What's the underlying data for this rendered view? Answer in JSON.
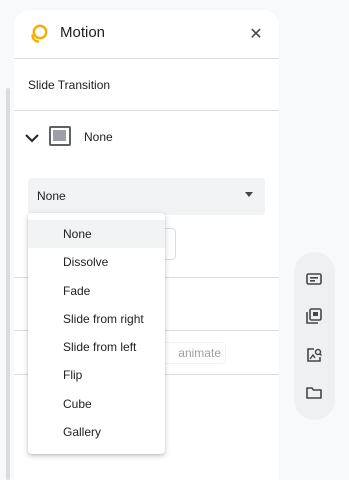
{
  "panel": {
    "title": "Motion",
    "close_icon": "close-icon",
    "motion_icon": "motion-icon",
    "brand_color": "#f9ab00"
  },
  "transition": {
    "section_title": "Slide Transition",
    "current_label": "None",
    "select_value": "None",
    "options": [
      "None",
      "Dissolve",
      "Fade",
      "Slide from right",
      "Slide from left",
      "Flip",
      "Cube",
      "Gallery"
    ],
    "selected_index": 0
  },
  "background": {
    "animate_label": "animate"
  },
  "side_rail": {
    "icons": [
      "keyboard-icon",
      "slides-stack-icon",
      "image-search-icon",
      "folder-icon"
    ]
  }
}
